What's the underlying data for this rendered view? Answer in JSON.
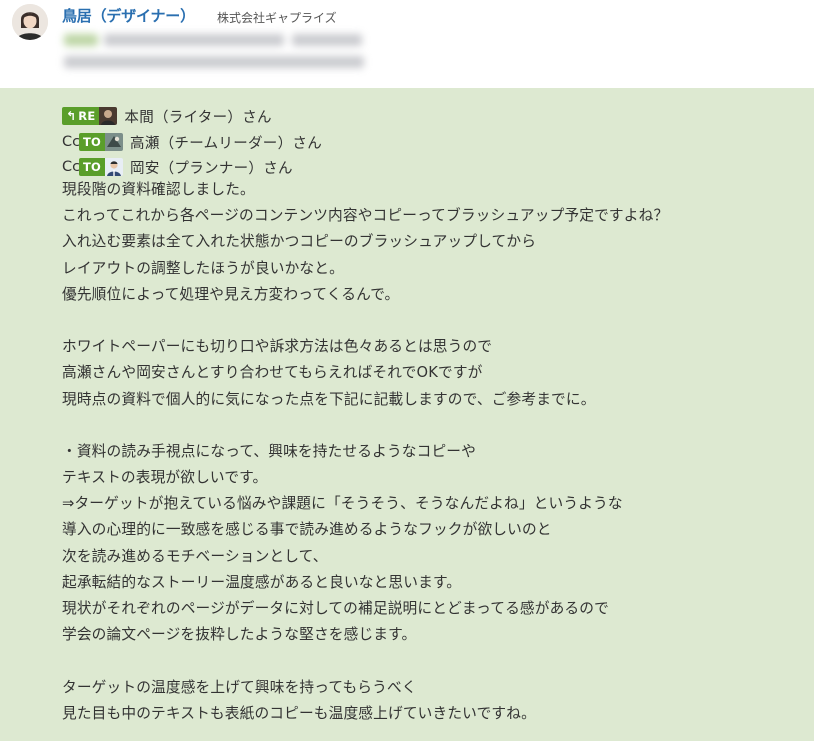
{
  "sender": {
    "name": "鳥居（デザイナー）",
    "company": "株式会社ギャプライズ"
  },
  "recipients": [
    {
      "prefix": "",
      "tag_icon": "reply-arrow-icon",
      "tag": "RE",
      "name": "本間（ライター）さん"
    },
    {
      "prefix": "Cc",
      "tag_icon": "",
      "tag": "TO",
      "name": "高瀬（チームリーダー）さん"
    },
    {
      "prefix": "Cc",
      "tag_icon": "",
      "tag": "TO",
      "name": "岡安（プランナー）さん"
    }
  ],
  "message_lines": [
    "現段階の資料確認しました。",
    "これってこれから各ページのコンテンツ内容やコピーってブラッシュアップ予定ですよね？",
    "入れ込む要素は全て入れた状態かつコピーのブラッシュアップしてから",
    "レイアウトの調整したほうが良いかなと。",
    "優先順位によって処理や見え方変わってくるんで。",
    "",
    "ホワイトペーパーにも切り口や訴求方法は色々あるとは思うので",
    "高瀬さんや岡安さんとすり合わせてもらえればそれでOKですが",
    "現時点の資料で個人的に気になった点を下記に記載しますので、ご参考までに。",
    "",
    "・資料の読み手視点になって、興味を持たせるようなコピーや",
    "テキストの表現が欲しいです。",
    "⇒ターゲットが抱えている悩みや課題に「そうそう、そうなんだよね」というような",
    "導入の心理的に一致感を感じる事で読み進めるようなフックが欲しいのと",
    "次を読み進めるモチベーションとして、",
    "起承転結的なストーリー温度感があると良いなと思います。",
    "現状がそれぞれのページがデータに対しての補足説明にとどまってる感があるので",
    "学会の論文ページを抜粋したような堅さを感じます。",
    "",
    "ターゲットの温度感を上げて興味を持ってもらうべく",
    "見た目も中のテキストも表紙のコピーも温度感上げていきたいですね。"
  ],
  "colors": {
    "message_bg": "#dde9d1",
    "tag_green": "#5a9e2a",
    "sender_blue": "#2a6fb0"
  }
}
